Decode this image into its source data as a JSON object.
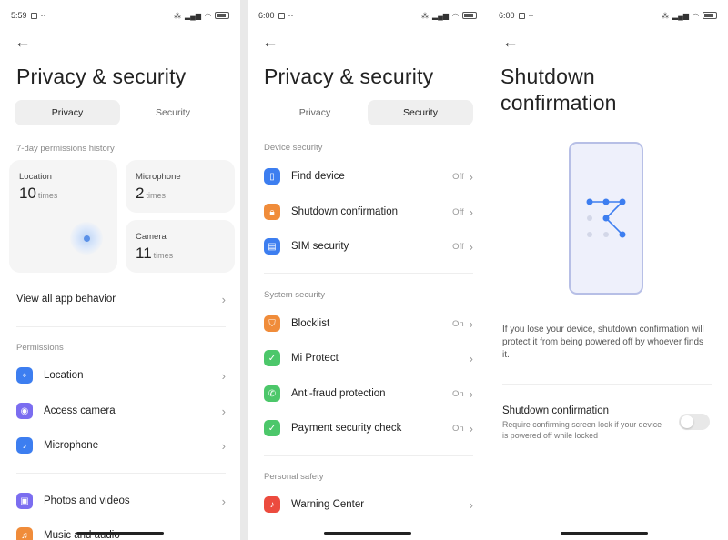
{
  "colors": {
    "accent": "#3d7ef0",
    "orange": "#f08c3a",
    "green": "#4cc76a",
    "red": "#ec4b3e",
    "purple": "#7b6df0"
  },
  "screen1": {
    "time": "5:59",
    "title": "Privacy & security",
    "tabs": [
      "Privacy",
      "Security"
    ],
    "history_label": "7-day permissions history",
    "cards": [
      {
        "label": "Location",
        "value": "10",
        "unit": "times"
      },
      {
        "label": "Microphone",
        "value": "2",
        "unit": "times"
      },
      {
        "label": "Camera",
        "value": "11",
        "unit": "times"
      }
    ],
    "view_all": "View all app behavior",
    "permissions_label": "Permissions",
    "permissions": [
      {
        "label": "Location",
        "icon": "location-icon"
      },
      {
        "label": "Access camera",
        "icon": "camera-icon"
      },
      {
        "label": "Microphone",
        "icon": "microphone-icon"
      },
      {
        "label": "Photos and videos",
        "icon": "photos-icon"
      },
      {
        "label": "Music and audio",
        "icon": "music-icon"
      }
    ]
  },
  "screen2": {
    "time": "6:00",
    "title": "Privacy & security",
    "tabs": [
      "Privacy",
      "Security"
    ],
    "device_label": "Device security",
    "device_items": [
      {
        "label": "Find device",
        "state": "Off",
        "icon": "find-device-icon"
      },
      {
        "label": "Shutdown confirmation",
        "state": "Off",
        "icon": "lock-icon"
      },
      {
        "label": "SIM security",
        "state": "Off",
        "icon": "sim-icon"
      }
    ],
    "system_label": "System security",
    "system_items": [
      {
        "label": "Blocklist",
        "state": "On",
        "icon": "shield-icon"
      },
      {
        "label": "Mi Protect",
        "state": "",
        "icon": "mi-protect-icon"
      },
      {
        "label": "Anti-fraud protection",
        "state": "On",
        "icon": "phone-icon"
      },
      {
        "label": "Payment security check",
        "state": "On",
        "icon": "payment-check-icon"
      }
    ],
    "personal_label": "Personal safety",
    "personal_items": [
      {
        "label": "Warning Center",
        "state": "",
        "icon": "bell-icon"
      }
    ]
  },
  "screen3": {
    "time": "6:00",
    "title_line1": "Shutdown",
    "title_line2": "confirmation",
    "description": "If you lose your device, shutdown confirmation will protect it from being powered off by whoever finds it.",
    "toggle_title": "Shutdown confirmation",
    "toggle_subtitle": "Require confirming screen lock if your device is powered off while locked",
    "toggle_on": false
  }
}
